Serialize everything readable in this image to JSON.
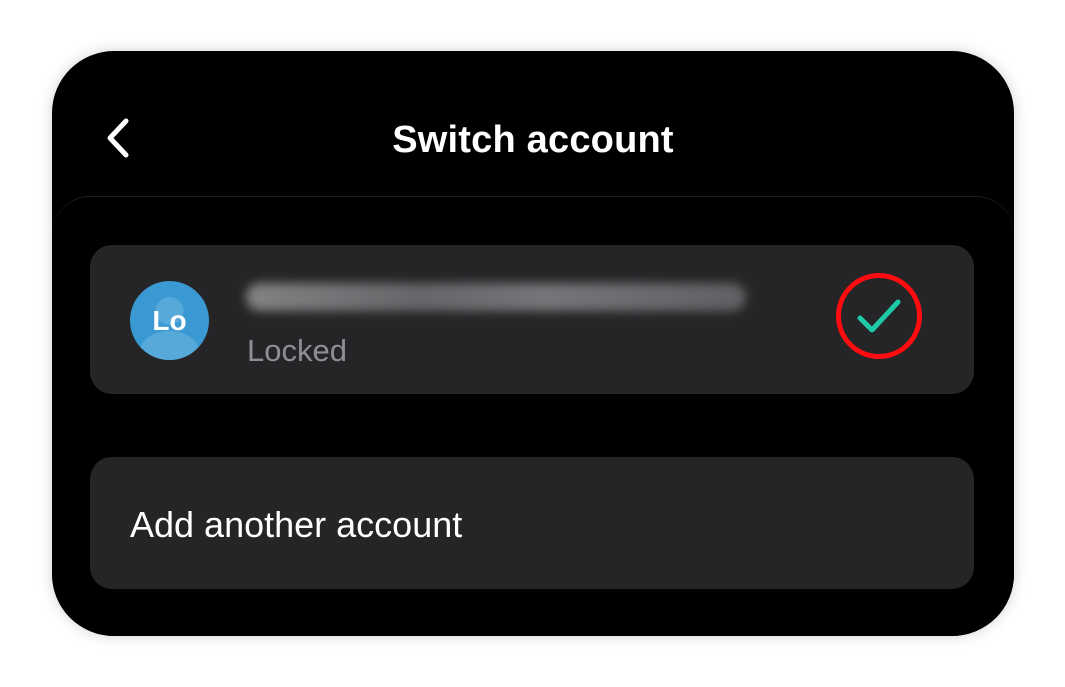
{
  "header": {
    "title": "Switch account",
    "back_icon": "chevron-left-icon"
  },
  "accounts": [
    {
      "initials": "Lo",
      "email": "",
      "status": "Locked",
      "selected": true,
      "check_icon": "checkmark-icon",
      "avatar_color": "#3a99d2",
      "check_color": "#1fc8a6",
      "highlight_color": "#ff0b10"
    }
  ],
  "add_account": {
    "label": "Add another account"
  }
}
